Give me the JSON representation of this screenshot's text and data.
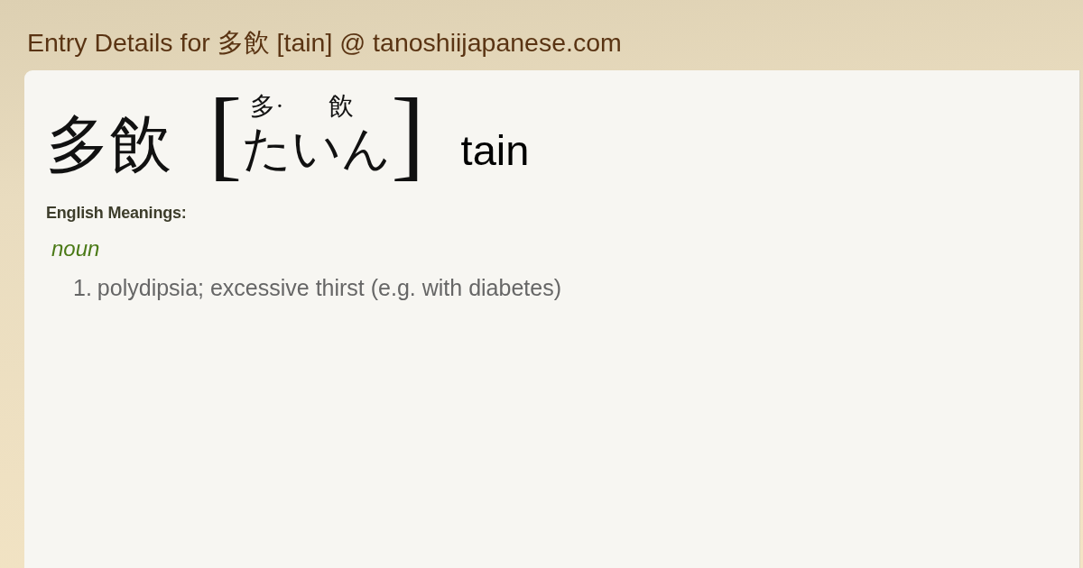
{
  "page_title": "Entry Details for 多飲 [tain] @ tanoshiijapanese.com",
  "entry": {
    "headword": "多飲",
    "open_bracket": "[",
    "reading": [
      {
        "furigana": "多·",
        "kana": "た"
      },
      {
        "furigana": "飲",
        "kana": "いん"
      }
    ],
    "close_bracket": "]",
    "romaji": "tain"
  },
  "meanings": {
    "heading": "English Meanings:",
    "groups": [
      {
        "part_of_speech": "noun",
        "senses": [
          {
            "number": "1.",
            "text": "polydipsia; excessive thirst (e.g. with diabetes)"
          }
        ]
      }
    ]
  }
}
